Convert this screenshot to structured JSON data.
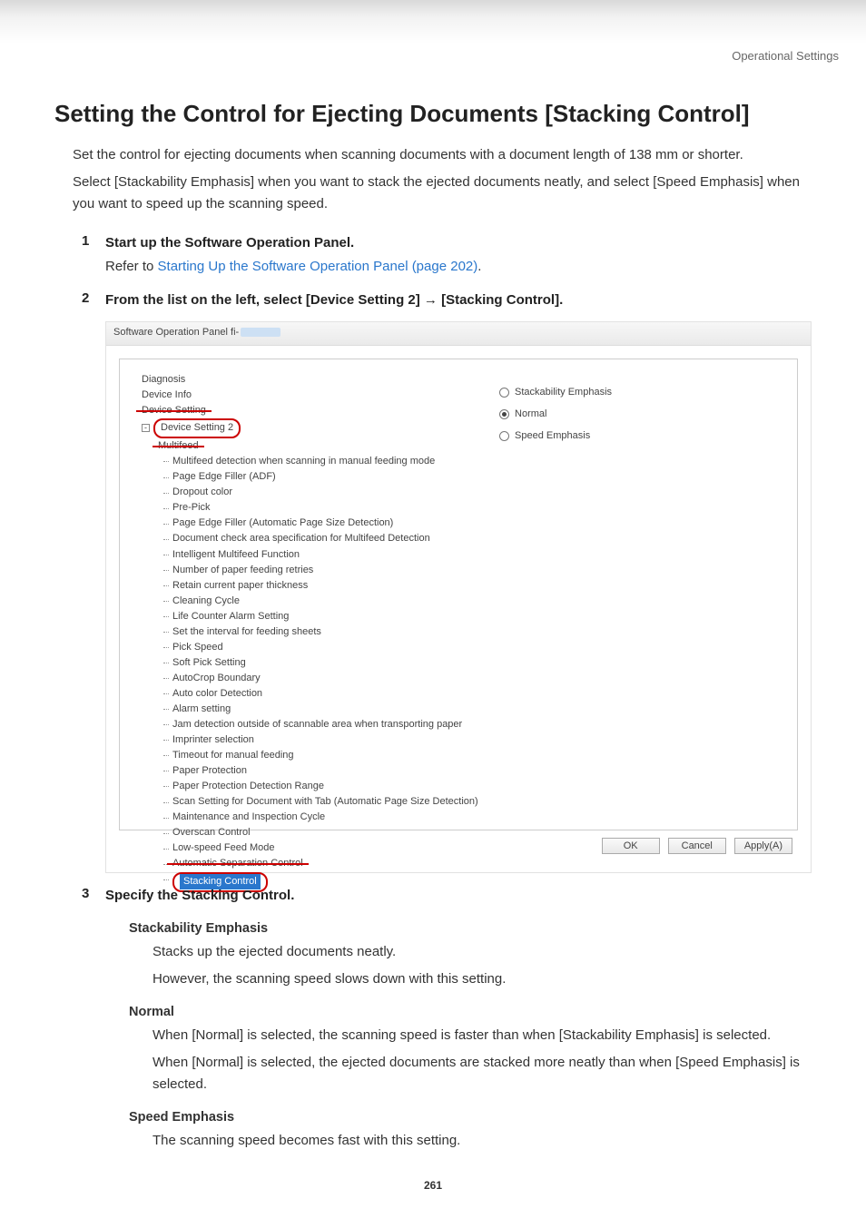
{
  "header": {
    "section_label": "Operational Settings"
  },
  "title": "Setting the Control for Ejecting Documents [Stacking Control]",
  "intro": {
    "p1": "Set the control for ejecting documents when scanning documents with a document length of 138 mm or shorter.",
    "p2": "Select [Stackability Emphasis] when you want to stack the ejected documents neatly, and select [Speed Emphasis] when you want to speed up the scanning speed."
  },
  "steps": {
    "s1": {
      "title": "Start up the Software Operation Panel.",
      "body_prefix": "Refer to ",
      "link_text": "Starting Up the Software Operation Panel (page 202)",
      "body_suffix": "."
    },
    "s2": {
      "title": "From the list on the left, select [Device Setting 2] → [Stacking Control]."
    },
    "s3": {
      "title": "Specify the Stacking Control."
    }
  },
  "dialog": {
    "title_prefix": "Software Operation Panel fi-",
    "tree": {
      "n_diagnosis": "Diagnosis",
      "n_device_info": "Device Info",
      "n_device_setting": "Device Setting",
      "n_device_setting2": "Device Setting 2",
      "n_multifeed_top": "Multifeed",
      "items": [
        "Multifeed detection when scanning in manual feeding mode",
        "Page Edge Filler (ADF)",
        "Dropout color",
        "Pre-Pick",
        "Page Edge Filler (Automatic Page Size Detection)",
        "Document check area specification for Multifeed Detection",
        "Intelligent Multifeed Function",
        "Number of paper feeding retries",
        "Retain current paper thickness",
        "Cleaning Cycle",
        "Life Counter Alarm Setting",
        "Set the interval for feeding sheets",
        "Pick Speed",
        "Soft Pick Setting",
        "AutoCrop Boundary",
        "Auto color Detection",
        "Alarm setting",
        "Jam detection outside of scannable area when transporting paper",
        "Imprinter selection",
        "Timeout for manual feeding",
        "Paper Protection",
        "Paper Protection Detection Range",
        "Scan Setting for Document with Tab (Automatic Page Size Detection)",
        "Maintenance and Inspection Cycle",
        "Overscan Control",
        "Low-speed Feed Mode"
      ],
      "n_auto_sep": "Automatic Separation Control",
      "n_stacking": "Stacking Control"
    },
    "options": {
      "opt1": "Stackability Emphasis",
      "opt2": "Normal",
      "opt3": "Speed Emphasis"
    },
    "buttons": {
      "ok": "OK",
      "cancel": "Cancel",
      "apply": "Apply(A)"
    }
  },
  "definitions": {
    "d1": {
      "term": "Stackability Emphasis",
      "line1": "Stacks up the ejected documents neatly.",
      "line2": "However, the scanning speed slows down with this setting."
    },
    "d2": {
      "term": "Normal",
      "line1": "When [Normal] is selected, the scanning speed is faster than when [Stackability Emphasis] is selected.",
      "line2": "When [Normal] is selected, the ejected documents are stacked more neatly than when [Speed Emphasis] is selected."
    },
    "d3": {
      "term": "Speed Emphasis",
      "line1": "The scanning speed becomes fast with this setting."
    }
  },
  "footer": {
    "page_no": "261"
  },
  "chart_data": {
    "type": "table",
    "note": "no chart present"
  }
}
